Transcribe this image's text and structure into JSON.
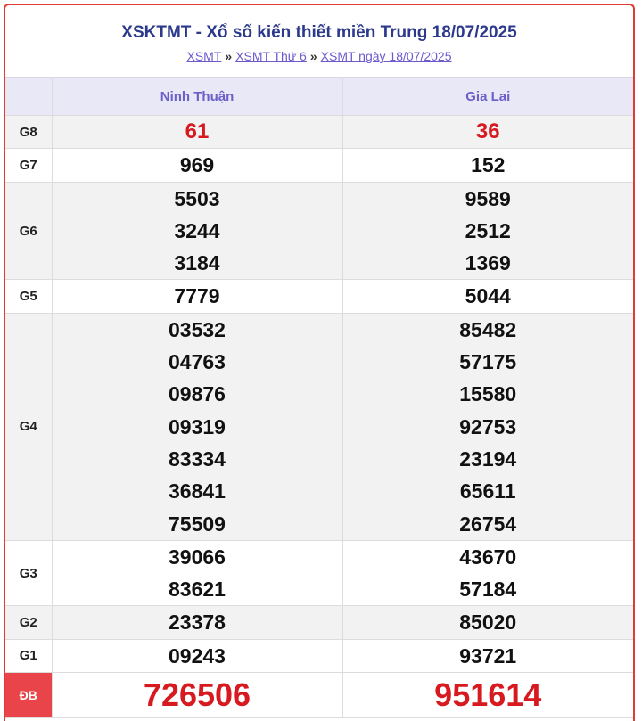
{
  "header": {
    "title": "XSKTMT - Xổ số kiến thiết miền Trung 18/07/2025",
    "breadcrumb": [
      {
        "label": "XSMT"
      },
      {
        "label": "XSMT Thứ 6"
      },
      {
        "label": "XSMT ngày 18/07/2025"
      }
    ],
    "separator": "»"
  },
  "provinces": [
    "Ninh Thuận",
    "Gia Lai"
  ],
  "prizes": [
    {
      "label": "G8",
      "ninh_thuan": [
        "61"
      ],
      "gia_lai": [
        "36"
      ]
    },
    {
      "label": "G7",
      "ninh_thuan": [
        "969"
      ],
      "gia_lai": [
        "152"
      ]
    },
    {
      "label": "G6",
      "ninh_thuan": [
        "5503",
        "3244",
        "3184"
      ],
      "gia_lai": [
        "9589",
        "2512",
        "1369"
      ]
    },
    {
      "label": "G5",
      "ninh_thuan": [
        "7779"
      ],
      "gia_lai": [
        "5044"
      ]
    },
    {
      "label": "G4",
      "ninh_thuan": [
        "03532",
        "04763",
        "09876",
        "09319",
        "83334",
        "36841",
        "75509"
      ],
      "gia_lai": [
        "85482",
        "57175",
        "15580",
        "92753",
        "23194",
        "65611",
        "26754"
      ]
    },
    {
      "label": "G3",
      "ninh_thuan": [
        "39066",
        "83621"
      ],
      "gia_lai": [
        "43670",
        "57184"
      ]
    },
    {
      "label": "G2",
      "ninh_thuan": [
        "23378"
      ],
      "gia_lai": [
        "85020"
      ]
    },
    {
      "label": "G1",
      "ninh_thuan": [
        "09243"
      ],
      "gia_lai": [
        "93721"
      ]
    },
    {
      "label": "ĐB",
      "ninh_thuan": [
        "726506"
      ],
      "gia_lai": [
        "951614"
      ]
    }
  ],
  "colors": {
    "accent_red": "#d71920",
    "title_blue": "#2d3a8c",
    "header_purple": "#6c5fc7",
    "special_label_bg": "#e8444a"
  }
}
